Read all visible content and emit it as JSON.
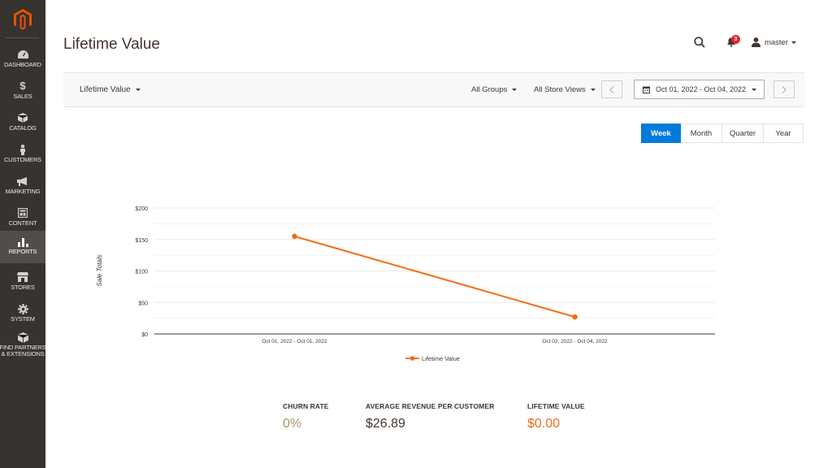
{
  "sidebar": {
    "items": [
      {
        "label": "DASHBOARD",
        "icon": "dashboard-icon"
      },
      {
        "label": "SALES",
        "icon": "dollar-icon"
      },
      {
        "label": "CATALOG",
        "icon": "cube-icon"
      },
      {
        "label": "CUSTOMERS",
        "icon": "person-icon"
      },
      {
        "label": "MARKETING",
        "icon": "megaphone-icon"
      },
      {
        "label": "CONTENT",
        "icon": "layout-icon"
      },
      {
        "label": "REPORTS",
        "icon": "bar-chart-icon",
        "active": true
      },
      {
        "label": "STORES",
        "icon": "store-icon"
      },
      {
        "label": "SYSTEM",
        "icon": "gear-icon"
      },
      {
        "label": "FIND PARTNERS",
        "label2": "& EXTENSIONS",
        "icon": "partners-icon"
      }
    ]
  },
  "header": {
    "title": "Lifetime Value",
    "notification_count": "3",
    "user_name": "master"
  },
  "toolbar": {
    "report_select": "Lifetime Value",
    "groups_select": "All Groups",
    "store_views_select": "All Store Views",
    "date_range": "Oct 01, 2022 - Oct 04, 2022"
  },
  "period": {
    "options": [
      "Week",
      "Month",
      "Quarter",
      "Year"
    ],
    "selected": "Week"
  },
  "chart_data": {
    "type": "line",
    "title": "",
    "xlabel": "",
    "ylabel": "Sale Totals",
    "categories": [
      "Oct 01, 2022 - Oct 01, 2022",
      "Oct 02, 2022 - Oct 04, 2022"
    ],
    "series": [
      {
        "name": "Lifetime Value",
        "values": [
          155,
          27
        ],
        "color": "#f26b13"
      }
    ],
    "ylim": [
      0,
      200
    ],
    "yticks": [
      0,
      50,
      100,
      150,
      200
    ],
    "ytick_labels": [
      "$0",
      "$50",
      "$100",
      "$150",
      "$200"
    ],
    "grid": true,
    "legend_position": "bottom"
  },
  "metrics": [
    {
      "label": "CHURN RATE",
      "value": "0%",
      "color": "#a6965f"
    },
    {
      "label": "AVERAGE REVENUE PER CUSTOMER",
      "value": "$26.89",
      "color": "#41362f"
    },
    {
      "label": "LIFETIME VALUE",
      "value": "$0.00",
      "color": "#f26b13"
    }
  ],
  "colors": {
    "sidebar_bg": "#373330",
    "accent": "#eb5202",
    "primary_button": "#007bdb",
    "series": "#f26b13"
  }
}
